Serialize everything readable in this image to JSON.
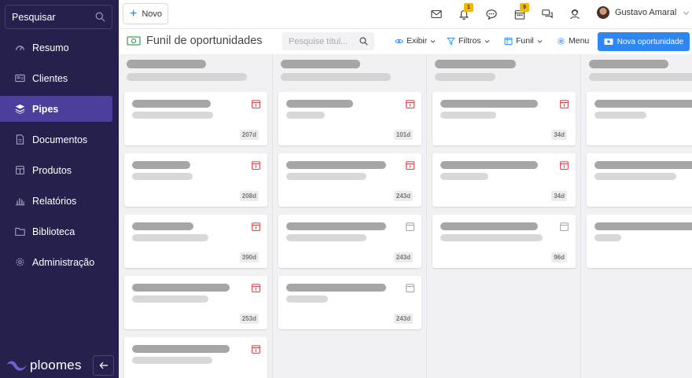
{
  "sidebar": {
    "search_label": "Pesquisar",
    "items": [
      {
        "label": "Resumo",
        "icon": "gauge-icon"
      },
      {
        "label": "Clientes",
        "icon": "contact-card-icon"
      },
      {
        "label": "Pipes",
        "icon": "layers-icon",
        "active": true
      },
      {
        "label": "Documentos",
        "icon": "document-icon"
      },
      {
        "label": "Produtos",
        "icon": "box-icon"
      },
      {
        "label": "Relatórios",
        "icon": "bar-chart-icon"
      },
      {
        "label": "Biblioteca",
        "icon": "folder-icon"
      },
      {
        "label": "Administração",
        "icon": "gear-icon"
      }
    ],
    "logo_text": "ploomes"
  },
  "header": {
    "new_label": "Novo",
    "notifications_count": "1",
    "calendar_count": "9",
    "user_name": "Gustavo Amaral"
  },
  "toolbar": {
    "title": "Funil de oportunidades",
    "search_placeholder": "Pesquise títul...",
    "view_label": "Exibir",
    "filters_label": "Filtros",
    "funnel_label": "Funil",
    "menu_label": "Menu",
    "new_opportunity_label": "Nova oportunidade"
  },
  "colors": {
    "sidebar_bg": "#25214c",
    "active_item": "#4b3f9c",
    "accent_blue": "#2e86f0",
    "overdue_red": "#e5484d",
    "badge_yellow": "#f5b700"
  },
  "board": {
    "columns": [
      {
        "cards": [
          {
            "age": "207d",
            "overdue": true
          },
          {
            "age": "208d",
            "overdue": true
          },
          {
            "age": "390d",
            "overdue": true
          },
          {
            "age": "253d",
            "overdue": true
          },
          {
            "age": "",
            "overdue": true
          }
        ]
      },
      {
        "cards": [
          {
            "age": "101d",
            "overdue": true
          },
          {
            "age": "243d",
            "overdue": true
          },
          {
            "age": "243d",
            "overdue": false
          },
          {
            "age": "243d",
            "overdue": false
          }
        ]
      },
      {
        "cards": [
          {
            "age": "34d",
            "overdue": true
          },
          {
            "age": "34d",
            "overdue": true
          },
          {
            "age": "96d",
            "overdue": false
          }
        ]
      },
      {
        "cards": [
          {
            "age": "",
            "overdue": false
          },
          {
            "age": "",
            "overdue": false
          },
          {
            "age": "",
            "overdue": false
          }
        ]
      }
    ]
  }
}
